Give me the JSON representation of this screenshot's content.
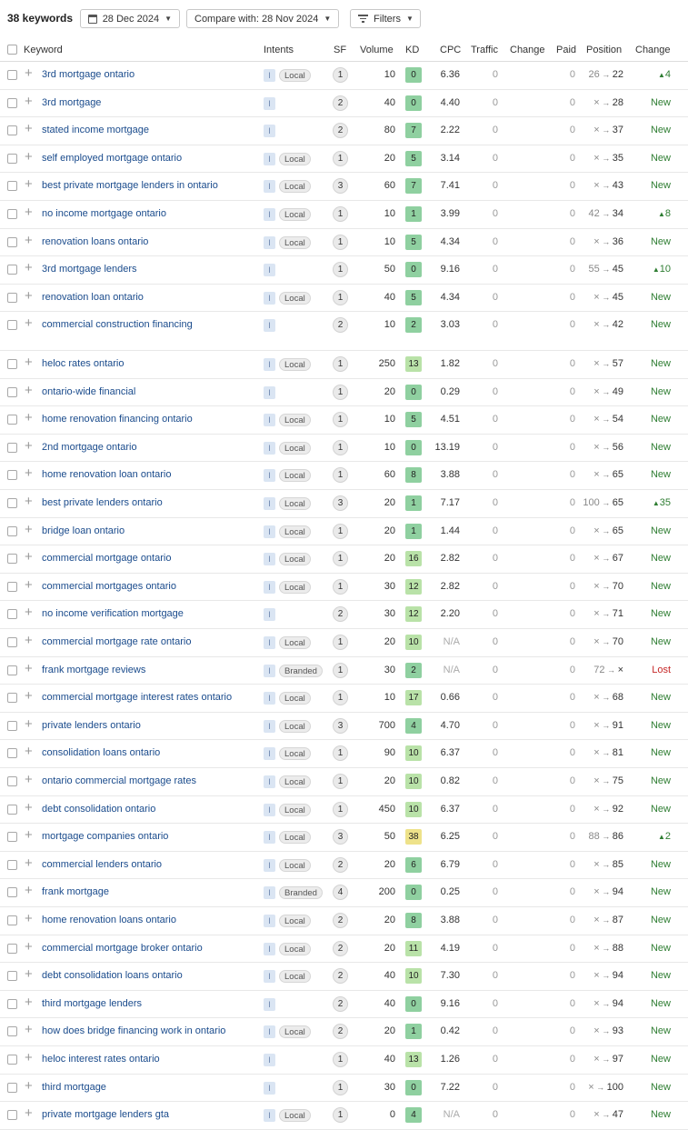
{
  "toolbar": {
    "keyword_count": "38 keywords",
    "date_label": "28 Dec 2024",
    "compare_label": "Compare with: 28 Nov 2024",
    "filters_label": "Filters"
  },
  "columns": {
    "keyword": "Keyword",
    "intents": "Intents",
    "sf": "SF",
    "volume": "Volume",
    "kd": "KD",
    "cpc": "CPC",
    "traffic": "Traffic",
    "change": "Change",
    "paid": "Paid",
    "position": "Position",
    "change2": "Change"
  },
  "colors": {
    "kd_green_dark": "#8fd0a0",
    "kd_green_light": "#b9e2a8",
    "kd_yellow": "#eee28a",
    "link": "#1a4b8c",
    "new_green": "#2e7d32",
    "lost_red": "#c62828"
  },
  "rows": [
    {
      "keyword": "3rd mortgage ontario",
      "intent": "I",
      "tag": "Local",
      "sf": "1",
      "volume": "10",
      "kd": "0",
      "cpc": "6.36",
      "traffic": "0",
      "paid": "0",
      "pos_from": "26",
      "pos_to": "22",
      "change": "4",
      "change_type": "up"
    },
    {
      "keyword": "3rd mortgage",
      "intent": "I",
      "tag": "",
      "sf": "2",
      "volume": "40",
      "kd": "0",
      "cpc": "4.40",
      "traffic": "0",
      "paid": "0",
      "pos_from": "×",
      "pos_to": "28",
      "change": "New",
      "change_type": "new"
    },
    {
      "keyword": "stated income mortgage",
      "intent": "I",
      "tag": "",
      "sf": "2",
      "volume": "80",
      "kd": "7",
      "cpc": "2.22",
      "traffic": "0",
      "paid": "0",
      "pos_from": "×",
      "pos_to": "37",
      "change": "New",
      "change_type": "new"
    },
    {
      "keyword": "self employed mortgage ontario",
      "intent": "I",
      "tag": "Local",
      "sf": "1",
      "volume": "20",
      "kd": "5",
      "cpc": "3.14",
      "traffic": "0",
      "paid": "0",
      "pos_from": "×",
      "pos_to": "35",
      "change": "New",
      "change_type": "new"
    },
    {
      "keyword": "best private mortgage lenders in ontario",
      "intent": "I",
      "tag": "Local",
      "sf": "3",
      "volume": "60",
      "kd": "7",
      "cpc": "7.41",
      "traffic": "0",
      "paid": "0",
      "pos_from": "×",
      "pos_to": "43",
      "change": "New",
      "change_type": "new"
    },
    {
      "keyword": "no income mortgage ontario",
      "intent": "I",
      "tag": "Local",
      "sf": "1",
      "volume": "10",
      "kd": "1",
      "cpc": "3.99",
      "traffic": "0",
      "paid": "0",
      "pos_from": "42",
      "pos_to": "34",
      "change": "8",
      "change_type": "up"
    },
    {
      "keyword": "renovation loans ontario",
      "intent": "I",
      "tag": "Local",
      "sf": "1",
      "volume": "10",
      "kd": "5",
      "cpc": "4.34",
      "traffic": "0",
      "paid": "0",
      "pos_from": "×",
      "pos_to": "36",
      "change": "New",
      "change_type": "new"
    },
    {
      "keyword": "3rd mortgage lenders",
      "intent": "I",
      "tag": "",
      "sf": "1",
      "volume": "50",
      "kd": "0",
      "cpc": "9.16",
      "traffic": "0",
      "paid": "0",
      "pos_from": "55",
      "pos_to": "45",
      "change": "10",
      "change_type": "up"
    },
    {
      "keyword": "renovation loan ontario",
      "intent": "I",
      "tag": "Local",
      "sf": "1",
      "volume": "40",
      "kd": "5",
      "cpc": "4.34",
      "traffic": "0",
      "paid": "0",
      "pos_from": "×",
      "pos_to": "45",
      "change": "New",
      "change_type": "new"
    },
    {
      "keyword": "commercial construction financing",
      "intent": "I",
      "tag": "",
      "sf": "2",
      "volume": "10",
      "kd": "2",
      "cpc": "3.03",
      "traffic": "0",
      "paid": "0",
      "pos_from": "×",
      "pos_to": "42",
      "change": "New",
      "change_type": "new"
    },
    {
      "keyword": "heloc rates ontario",
      "intent": "I",
      "tag": "Local",
      "sf": "1",
      "volume": "250",
      "kd": "13",
      "cpc": "1.82",
      "traffic": "0",
      "paid": "0",
      "pos_from": "×",
      "pos_to": "57",
      "change": "New",
      "change_type": "new"
    },
    {
      "keyword": "ontario-wide financial",
      "intent": "I",
      "tag": "",
      "sf": "1",
      "volume": "20",
      "kd": "0",
      "cpc": "0.29",
      "traffic": "0",
      "paid": "0",
      "pos_from": "×",
      "pos_to": "49",
      "change": "New",
      "change_type": "new"
    },
    {
      "keyword": "home renovation financing ontario",
      "intent": "I",
      "tag": "Local",
      "sf": "1",
      "volume": "10",
      "kd": "5",
      "cpc": "4.51",
      "traffic": "0",
      "paid": "0",
      "pos_from": "×",
      "pos_to": "54",
      "change": "New",
      "change_type": "new"
    },
    {
      "keyword": "2nd mortgage ontario",
      "intent": "I",
      "tag": "Local",
      "sf": "1",
      "volume": "10",
      "kd": "0",
      "cpc": "13.19",
      "traffic": "0",
      "paid": "0",
      "pos_from": "×",
      "pos_to": "56",
      "change": "New",
      "change_type": "new"
    },
    {
      "keyword": "home renovation loan ontario",
      "intent": "I",
      "tag": "Local",
      "sf": "1",
      "volume": "60",
      "kd": "8",
      "cpc": "3.88",
      "traffic": "0",
      "paid": "0",
      "pos_from": "×",
      "pos_to": "65",
      "change": "New",
      "change_type": "new"
    },
    {
      "keyword": "best private lenders ontario",
      "intent": "I",
      "tag": "Local",
      "sf": "3",
      "volume": "20",
      "kd": "1",
      "cpc": "7.17",
      "traffic": "0",
      "paid": "0",
      "pos_from": "100",
      "pos_to": "65",
      "change": "35",
      "change_type": "up"
    },
    {
      "keyword": "bridge loan ontario",
      "intent": "I",
      "tag": "Local",
      "sf": "1",
      "volume": "20",
      "kd": "1",
      "cpc": "1.44",
      "traffic": "0",
      "paid": "0",
      "pos_from": "×",
      "pos_to": "65",
      "change": "New",
      "change_type": "new"
    },
    {
      "keyword": "commercial mortgage ontario",
      "intent": "I",
      "tag": "Local",
      "sf": "1",
      "volume": "20",
      "kd": "16",
      "cpc": "2.82",
      "traffic": "0",
      "paid": "0",
      "pos_from": "×",
      "pos_to": "67",
      "change": "New",
      "change_type": "new"
    },
    {
      "keyword": "commercial mortgages ontario",
      "intent": "I",
      "tag": "Local",
      "sf": "1",
      "volume": "30",
      "kd": "12",
      "cpc": "2.82",
      "traffic": "0",
      "paid": "0",
      "pos_from": "×",
      "pos_to": "70",
      "change": "New",
      "change_type": "new"
    },
    {
      "keyword": "no income verification mortgage",
      "intent": "I",
      "tag": "",
      "sf": "2",
      "volume": "30",
      "kd": "12",
      "cpc": "2.20",
      "traffic": "0",
      "paid": "0",
      "pos_from": "×",
      "pos_to": "71",
      "change": "New",
      "change_type": "new"
    },
    {
      "keyword": "commercial mortgage rate ontario",
      "intent": "I",
      "tag": "Local",
      "sf": "1",
      "volume": "20",
      "kd": "10",
      "cpc": "N/A",
      "traffic": "0",
      "paid": "0",
      "pos_from": "×",
      "pos_to": "70",
      "change": "New",
      "change_type": "new"
    },
    {
      "keyword": "frank mortgage reviews",
      "intent": "I",
      "tag": "Branded",
      "sf": "1",
      "volume": "30",
      "kd": "2",
      "cpc": "N/A",
      "traffic": "0",
      "paid": "0",
      "pos_from": "72",
      "pos_to": "×",
      "change": "Lost",
      "change_type": "lost"
    },
    {
      "keyword": "commercial mortgage interest rates ontario",
      "intent": "I",
      "tag": "Local",
      "sf": "1",
      "volume": "10",
      "kd": "17",
      "cpc": "0.66",
      "traffic": "0",
      "paid": "0",
      "pos_from": "×",
      "pos_to": "68",
      "change": "New",
      "change_type": "new"
    },
    {
      "keyword": "private lenders ontario",
      "intent": "I",
      "tag": "Local",
      "sf": "3",
      "volume": "700",
      "kd": "4",
      "cpc": "4.70",
      "traffic": "0",
      "paid": "0",
      "pos_from": "×",
      "pos_to": "91",
      "change": "New",
      "change_type": "new"
    },
    {
      "keyword": "consolidation loans ontario",
      "intent": "I",
      "tag": "Local",
      "sf": "1",
      "volume": "90",
      "kd": "10",
      "cpc": "6.37",
      "traffic": "0",
      "paid": "0",
      "pos_from": "×",
      "pos_to": "81",
      "change": "New",
      "change_type": "new"
    },
    {
      "keyword": "ontario commercial mortgage rates",
      "intent": "I",
      "tag": "Local",
      "sf": "1",
      "volume": "20",
      "kd": "10",
      "cpc": "0.82",
      "traffic": "0",
      "paid": "0",
      "pos_from": "×",
      "pos_to": "75",
      "change": "New",
      "change_type": "new"
    },
    {
      "keyword": "debt consolidation ontario",
      "intent": "I",
      "tag": "Local",
      "sf": "1",
      "volume": "450",
      "kd": "10",
      "cpc": "6.37",
      "traffic": "0",
      "paid": "0",
      "pos_from": "×",
      "pos_to": "92",
      "change": "New",
      "change_type": "new"
    },
    {
      "keyword": "mortgage companies ontario",
      "intent": "I",
      "tag": "Local",
      "sf": "3",
      "volume": "50",
      "kd": "38",
      "cpc": "6.25",
      "traffic": "0",
      "paid": "0",
      "pos_from": "88",
      "pos_to": "86",
      "change": "2",
      "change_type": "up"
    },
    {
      "keyword": "commercial lenders ontario",
      "intent": "I",
      "tag": "Local",
      "sf": "2",
      "volume": "20",
      "kd": "6",
      "cpc": "6.79",
      "traffic": "0",
      "paid": "0",
      "pos_from": "×",
      "pos_to": "85",
      "change": "New",
      "change_type": "new"
    },
    {
      "keyword": "frank mortgage",
      "intent": "I",
      "tag": "Branded",
      "sf": "4",
      "volume": "200",
      "kd": "0",
      "cpc": "0.25",
      "traffic": "0",
      "paid": "0",
      "pos_from": "×",
      "pos_to": "94",
      "change": "New",
      "change_type": "new"
    },
    {
      "keyword": "home renovation loans ontario",
      "intent": "I",
      "tag": "Local",
      "sf": "2",
      "volume": "20",
      "kd": "8",
      "cpc": "3.88",
      "traffic": "0",
      "paid": "0",
      "pos_from": "×",
      "pos_to": "87",
      "change": "New",
      "change_type": "new"
    },
    {
      "keyword": "commercial mortgage broker ontario",
      "intent": "I",
      "tag": "Local",
      "sf": "2",
      "volume": "20",
      "kd": "11",
      "cpc": "4.19",
      "traffic": "0",
      "paid": "0",
      "pos_from": "×",
      "pos_to": "88",
      "change": "New",
      "change_type": "new"
    },
    {
      "keyword": "debt consolidation loans ontario",
      "intent": "I",
      "tag": "Local",
      "sf": "2",
      "volume": "40",
      "kd": "10",
      "cpc": "7.30",
      "traffic": "0",
      "paid": "0",
      "pos_from": "×",
      "pos_to": "94",
      "change": "New",
      "change_type": "new"
    },
    {
      "keyword": "third mortgage lenders",
      "intent": "I",
      "tag": "",
      "sf": "2",
      "volume": "40",
      "kd": "0",
      "cpc": "9.16",
      "traffic": "0",
      "paid": "0",
      "pos_from": "×",
      "pos_to": "94",
      "change": "New",
      "change_type": "new"
    },
    {
      "keyword": "how does bridge financing work in ontario",
      "intent": "I",
      "tag": "Local",
      "sf": "2",
      "volume": "20",
      "kd": "1",
      "cpc": "0.42",
      "traffic": "0",
      "paid": "0",
      "pos_from": "×",
      "pos_to": "93",
      "change": "New",
      "change_type": "new"
    },
    {
      "keyword": "heloc interest rates ontario",
      "intent": "I",
      "tag": "",
      "sf": "1",
      "volume": "40",
      "kd": "13",
      "cpc": "1.26",
      "traffic": "0",
      "paid": "0",
      "pos_from": "×",
      "pos_to": "97",
      "change": "New",
      "change_type": "new"
    },
    {
      "keyword": "third mortgage",
      "intent": "I",
      "tag": "",
      "sf": "1",
      "volume": "30",
      "kd": "0",
      "cpc": "7.22",
      "traffic": "0",
      "paid": "0",
      "pos_from": "×",
      "pos_to": "100",
      "change": "New",
      "change_type": "new"
    },
    {
      "keyword": "private mortgage lenders gta",
      "intent": "I",
      "tag": "Local",
      "sf": "1",
      "volume": "0",
      "kd": "4",
      "cpc": "N/A",
      "traffic": "0",
      "paid": "0",
      "pos_from": "×",
      "pos_to": "47",
      "change": "New",
      "change_type": "new"
    }
  ]
}
